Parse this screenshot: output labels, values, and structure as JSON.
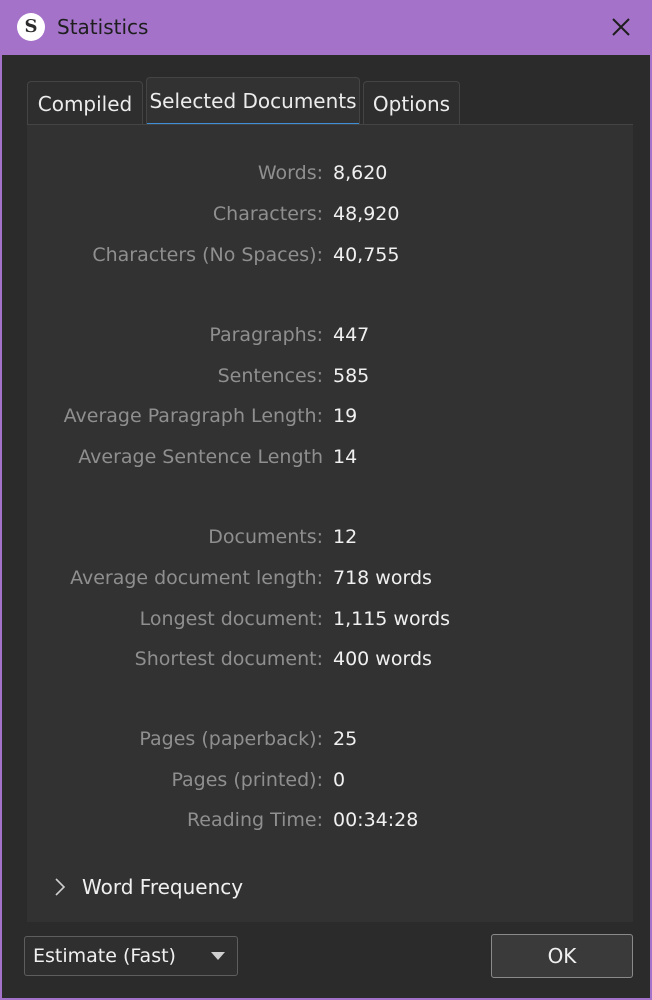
{
  "window": {
    "title": "Statistics",
    "app_icon_letter": "S",
    "accent_color": "#a472c9",
    "tab_underline_color": "#3f8fd6"
  },
  "tabs": [
    {
      "label": "Compiled",
      "active": false
    },
    {
      "label": "Selected Documents",
      "active": true
    },
    {
      "label": "Options",
      "active": false
    }
  ],
  "stats": {
    "words": {
      "label": "Words:",
      "value": "8,620"
    },
    "characters": {
      "label": "Characters:",
      "value": "48,920"
    },
    "characters_no_spaces": {
      "label": "Characters (No Spaces):",
      "value": "40,755"
    },
    "paragraphs": {
      "label": "Paragraphs:",
      "value": "447"
    },
    "sentences": {
      "label": "Sentences:",
      "value": "585"
    },
    "avg_paragraph_length": {
      "label": "Average Paragraph Length:",
      "value": "19"
    },
    "avg_sentence_length": {
      "label": "Average Sentence Length",
      "value": "14"
    },
    "documents": {
      "label": "Documents:",
      "value": "12"
    },
    "avg_document_length": {
      "label": "Average document length:",
      "value": "718 words"
    },
    "longest_document": {
      "label": "Longest document:",
      "value": "1,115 words"
    },
    "shortest_document": {
      "label": "Shortest document:",
      "value": "400 words"
    },
    "pages_paperback": {
      "label": "Pages (paperback):",
      "value": "25"
    },
    "pages_printed": {
      "label": "Pages (printed):",
      "value": "0"
    },
    "reading_time": {
      "label": "Reading Time:",
      "value": "00:34:28"
    }
  },
  "word_frequency": {
    "label": "Word Frequency",
    "expanded": false,
    "icon": "chevron-right-icon"
  },
  "footer": {
    "count_mode": {
      "selected": "Estimate (Fast)",
      "icon": "caret-down-icon"
    },
    "ok_label": "OK"
  }
}
